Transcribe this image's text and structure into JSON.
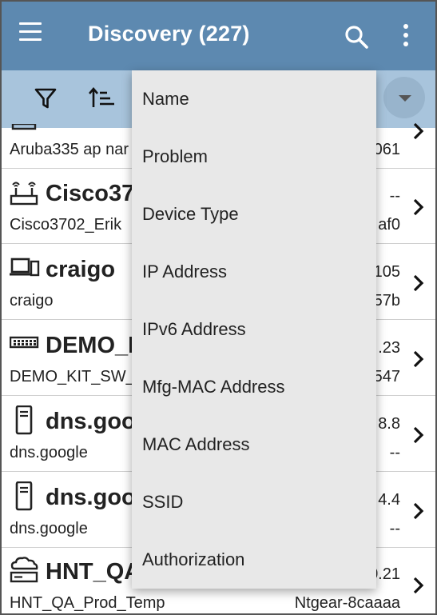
{
  "appbar": {
    "title": "Discovery (227)",
    "icons": {
      "menu": "hamburger-menu-icon",
      "search": "search-icon",
      "more": "more-vert-icon"
    }
  },
  "toolbar": {
    "icons": {
      "filter": "filter-icon",
      "sort": "sort-icon",
      "dropdown": "arrow-drop-down-icon"
    }
  },
  "colors": {
    "appbar": "#5d89b0",
    "toolbar": "#a8c4dc",
    "menu_bg": "#e8e8e8"
  },
  "rows": [
    {
      "name": "",
      "sub": "Aruba335 ap nar",
      "right_top": "",
      "right_bottom": "061",
      "icon": "access-point-icon"
    },
    {
      "name": "Cisco37",
      "sub": "Cisco3702_Erik",
      "right_top": "--",
      "right_bottom": "af0",
      "icon": "wifi-router-icon"
    },
    {
      "name": "craigo",
      "sub": "craigo",
      "right_top": "105",
      "right_bottom": "57b",
      "icon": "laptop-device-icon"
    },
    {
      "name": "DEMO_KI",
      "sub": "DEMO_KIT_SW_3",
      "right_top": ".23",
      "right_bottom": "547",
      "icon": "switch-icon"
    },
    {
      "name": "dns.goo",
      "sub": "dns.google",
      "right_top": "8.8",
      "right_bottom": "--",
      "icon": "server-icon"
    },
    {
      "name": "dns.goo",
      "sub": "dns.google",
      "right_top": "4.4",
      "right_bottom": "--",
      "icon": "server-icon"
    },
    {
      "name": "HNT_QA",
      "sub": "HNT_QA_Prod_Temp",
      "right_top": "0.21",
      "right_bottom": "Ntgear-8caaaa",
      "icon": "cloud-router-icon"
    }
  ],
  "sort_menu": {
    "items": [
      "Name",
      "Problem",
      "Device Type",
      "IP Address",
      "IPv6 Address",
      "Mfg-MAC Address",
      "MAC Address",
      "SSID",
      "Authorization"
    ]
  }
}
